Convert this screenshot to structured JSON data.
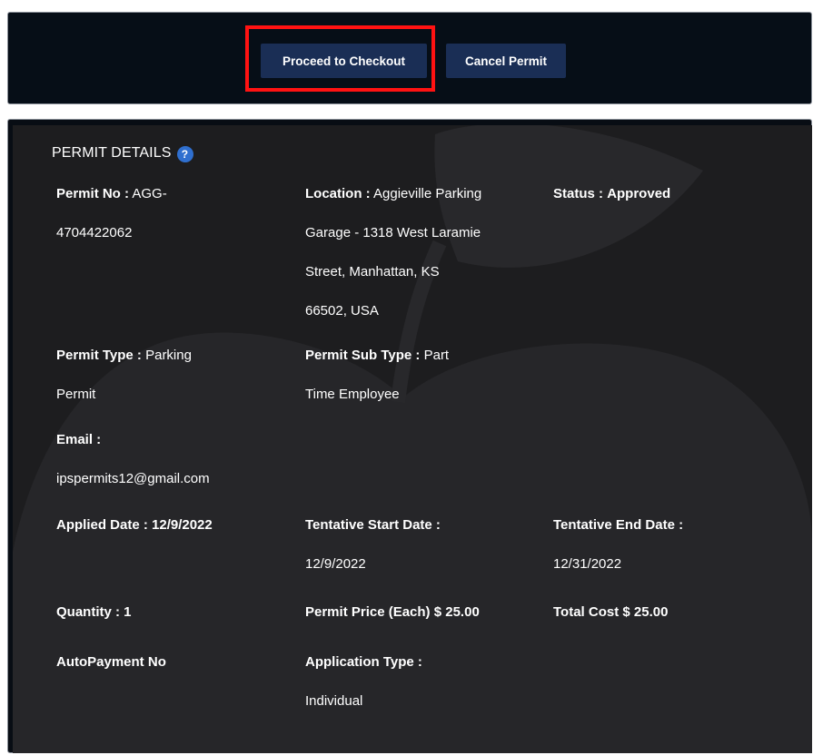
{
  "actions": {
    "proceed_label": "Proceed to Checkout",
    "cancel_label": "Cancel Permit"
  },
  "details": {
    "title": "PERMIT DETAILS",
    "help_icon": "question-circle-icon",
    "permit_no": {
      "label": "Permit No :",
      "line1": "AGG-",
      "line2": "4704422062"
    },
    "location": {
      "label": "Location :",
      "line1": "Aggieville Parking",
      "line2": "Garage - 1318 West Laramie",
      "line3": "Street, Manhattan, KS",
      "line4": "66502, USA"
    },
    "status": {
      "label": "Status :",
      "value": "Approved"
    },
    "permit_type": {
      "label": "Permit Type :",
      "line1": "Parking",
      "line2": "Permit"
    },
    "permit_sub_type": {
      "label": "Permit Sub Type :",
      "line1": "Part",
      "line2": "Time Employee"
    },
    "email": {
      "label": "Email :",
      "value": "ipspermits12@gmail.com"
    },
    "applied_date": {
      "label": "Applied Date :",
      "value": "12/9/2022"
    },
    "tentative_start": {
      "label": "Tentative Start Date :",
      "value": "12/9/2022"
    },
    "tentative_end": {
      "label": "Tentative End Date :",
      "value": "12/31/2022"
    },
    "quantity": {
      "label": "Quantity :",
      "value": "1"
    },
    "permit_price": {
      "label": "Permit Price (Each) $",
      "value": "25.00"
    },
    "total_cost": {
      "label": "Total Cost $",
      "value": "25.00"
    },
    "autopayment": {
      "label": "AutoPayment",
      "value": "No"
    },
    "application_type": {
      "label": "Application Type :",
      "value": "Individual"
    }
  },
  "colors": {
    "panel_bg": "#060e17",
    "detail_bg": "#1d1d1f",
    "button_bg": "#1a2e55",
    "highlight": "#ff1212",
    "help_icon": "#2f6fcf"
  }
}
